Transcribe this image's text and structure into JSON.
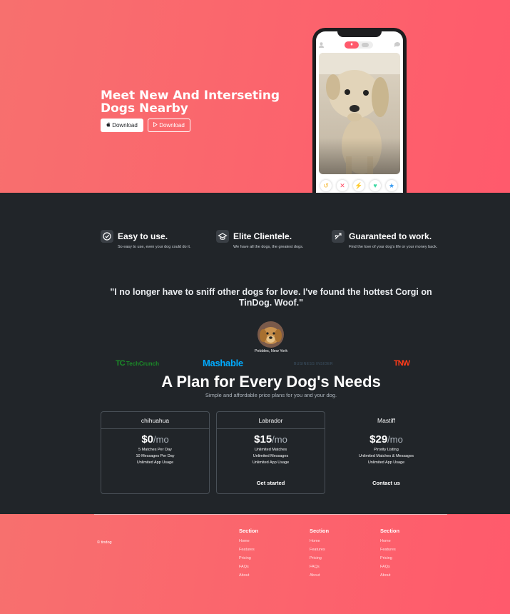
{
  "hero": {
    "title": "Meet New And Interseting Dogs Nearby",
    "download_label_1": "Download",
    "download_label_2": "Download",
    "accent_color": "#ff5a6c"
  },
  "phone": {
    "icons": [
      "user-icon",
      "flame-icon",
      "chat-icon"
    ],
    "actions": [
      "undo-icon",
      "close-icon",
      "bolt-icon",
      "heart-icon",
      "star-icon"
    ]
  },
  "features": [
    {
      "title": "Easy to use.",
      "description": "So easy to use, even your dog could do it.",
      "icon": "check-circle-icon"
    },
    {
      "title": "Elite Clientele.",
      "description": "We have all the dogs, the greatest dogs.",
      "icon": "graduation-cap-icon"
    },
    {
      "title": "Guaranteed to work.",
      "description": "Find the love of your dog's life or your money back.",
      "icon": "heart-arrow-icon"
    }
  ],
  "testimonial": {
    "quote": "\"I no longer have to sniff other dogs for love. I've found the hottest Corgi on TinDog. Woof.\"",
    "author": "Pebbles, New York"
  },
  "press": {
    "techcrunch_text": "TechCrunch",
    "mashable_text": "Mashable",
    "business_insider_text": "BUSINESS INSIDER",
    "tnw_text": "TNW"
  },
  "pricing": {
    "title": "A Plan for Every Dog's Needs",
    "subtitle": "Simple and affordable price plans for you and your dog.",
    "plans": [
      {
        "name": "chihuahua",
        "price": "$0",
        "per": "/mo",
        "features": [
          "5 Matches Per Day",
          "10 Messages Per Day",
          "Unlimited App Usage"
        ],
        "button": ""
      },
      {
        "name": "Labrador",
        "price": "$15",
        "per": "/mo",
        "features": [
          "Unlimited Matches",
          "Unlimited Messages",
          "Unlimited App Usage"
        ],
        "button": "Get started"
      },
      {
        "name": "Mastiff",
        "price": "$29",
        "per": "/mo",
        "features": [
          "Pirority Listing",
          "Unlimited Matches & Messages",
          "Unlimited App Usage"
        ],
        "button": "Contact us"
      }
    ]
  },
  "footer": {
    "copyright": "© tindog",
    "columns": [
      {
        "title": "Section",
        "links": [
          "Home",
          "Features",
          "Pricing",
          "FAQs",
          "About"
        ]
      },
      {
        "title": "Section",
        "links": [
          "Home",
          "Features",
          "Pricing",
          "FAQs",
          "About"
        ]
      },
      {
        "title": "Section",
        "links": [
          "Home",
          "Features",
          "Pricing",
          "FAQs",
          "About"
        ]
      }
    ]
  }
}
